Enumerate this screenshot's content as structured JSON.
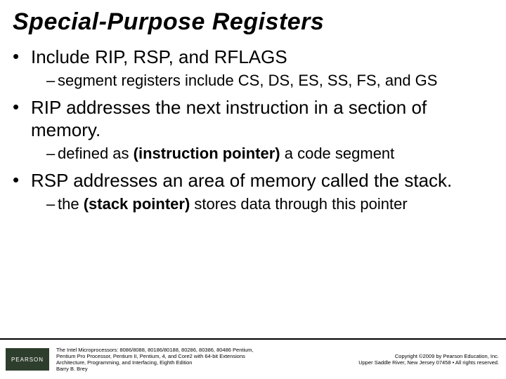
{
  "title": "Special-Purpose Registers",
  "bullets": {
    "b1": "Include RIP, RSP, and RFLAGS",
    "s1": "segment registers include CS, DS, ES, SS, FS, and GS",
    "b2": "RIP addresses the next instruction in a section of memory.",
    "s2_pre": "defined as ",
    "s2_bold": "(instruction pointer)",
    "s2_post": " a code segment",
    "b3": "RSP addresses an area of memory called the stack.",
    "s3_pre": "the ",
    "s3_bold": "(stack pointer)",
    "s3_post": " stores data through this pointer"
  },
  "footer": {
    "logo": "PEARSON",
    "book_line1": "The Intel Microprocessors: 8086/8088, 80186/80188, 80286, 80386, 80486 Pentium,",
    "book_line2": "Pentium Pro Processor, Pentium II, Pentium, 4, and Core2 with 64-bit Extensions",
    "book_line3": "Architecture, Programming, and Interfacing, Eighth Edition",
    "book_line4": "Barry B. Brey",
    "copy_line1": "Copyright ©2009 by Pearson Education, Inc.",
    "copy_line2": "Upper Saddle River, New Jersey 07458 • All rights reserved."
  }
}
